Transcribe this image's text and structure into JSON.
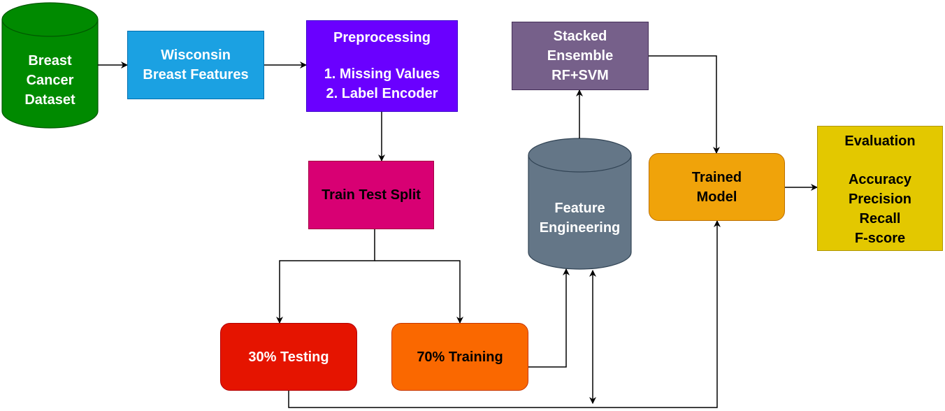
{
  "diagram": {
    "nodes": {
      "dataset": {
        "lines": [
          "Breast",
          "Cancer",
          "Dataset"
        ],
        "shape": "cylinder",
        "fill": "#008a00",
        "stroke": "#005700",
        "text_color": "#ffffff"
      },
      "features": {
        "lines": [
          "Wisconsin",
          "Breast Features"
        ],
        "shape": "rectangle",
        "fill": "#1ba1e2",
        "stroke": "#006eaf",
        "text_color": "#ffffff"
      },
      "preprocessing": {
        "lines": [
          "Preprocessing",
          "",
          "1. Missing Values",
          "2. Label Encoder"
        ],
        "shape": "rectangle",
        "fill": "#6a00ff",
        "stroke": "#3700cc",
        "text_color": "#ffffff"
      },
      "split": {
        "lines": [
          "Train Test Split"
        ],
        "shape": "rectangle",
        "fill": "#d80073",
        "stroke": "#a50040",
        "text_color": "#000000"
      },
      "testing": {
        "lines": [
          "30% Testing"
        ],
        "shape": "rounded-rectangle",
        "fill": "#e51400",
        "stroke": "#b20000",
        "text_color": "#ffffff"
      },
      "training": {
        "lines": [
          "70% Training"
        ],
        "shape": "rounded-rectangle",
        "fill": "#fa6800",
        "stroke": "#c73500",
        "text_color": "#000000"
      },
      "feature_engineering": {
        "lines": [
          "Feature",
          "Engineering"
        ],
        "shape": "cylinder",
        "fill": "#647687",
        "stroke": "#314354",
        "text_color": "#ffffff"
      },
      "ensemble": {
        "lines": [
          "Stacked",
          "Ensemble",
          "RF+SVM"
        ],
        "shape": "rectangle",
        "fill": "#76608a",
        "stroke": "#432d57",
        "text_color": "#ffffff"
      },
      "trained_model": {
        "lines": [
          "Trained",
          "Model"
        ],
        "shape": "rounded-rectangle",
        "fill": "#f0a30a",
        "stroke": "#bd7000",
        "text_color": "#000000"
      },
      "evaluation": {
        "lines": [
          "Evaluation",
          "",
          "Accuracy",
          "Precision",
          "Recall",
          "F-score"
        ],
        "shape": "rectangle",
        "fill": "#e3c800",
        "stroke": "#b09500",
        "text_color": "#000000"
      }
    },
    "edges": [
      {
        "from": "dataset",
        "to": "features"
      },
      {
        "from": "features",
        "to": "preprocessing"
      },
      {
        "from": "preprocessing",
        "to": "split"
      },
      {
        "from": "split",
        "to": "testing"
      },
      {
        "from": "split",
        "to": "training"
      },
      {
        "from": "training",
        "to": "feature_engineering"
      },
      {
        "from": "feature_engineering",
        "to": "ensemble"
      },
      {
        "from": "ensemble",
        "to": "trained_model"
      },
      {
        "from": "testing",
        "to": "trained_model"
      },
      {
        "from": "feature_engineering",
        "to": "testing-line",
        "bidirectional": true
      },
      {
        "from": "trained_model",
        "to": "evaluation"
      }
    ]
  }
}
